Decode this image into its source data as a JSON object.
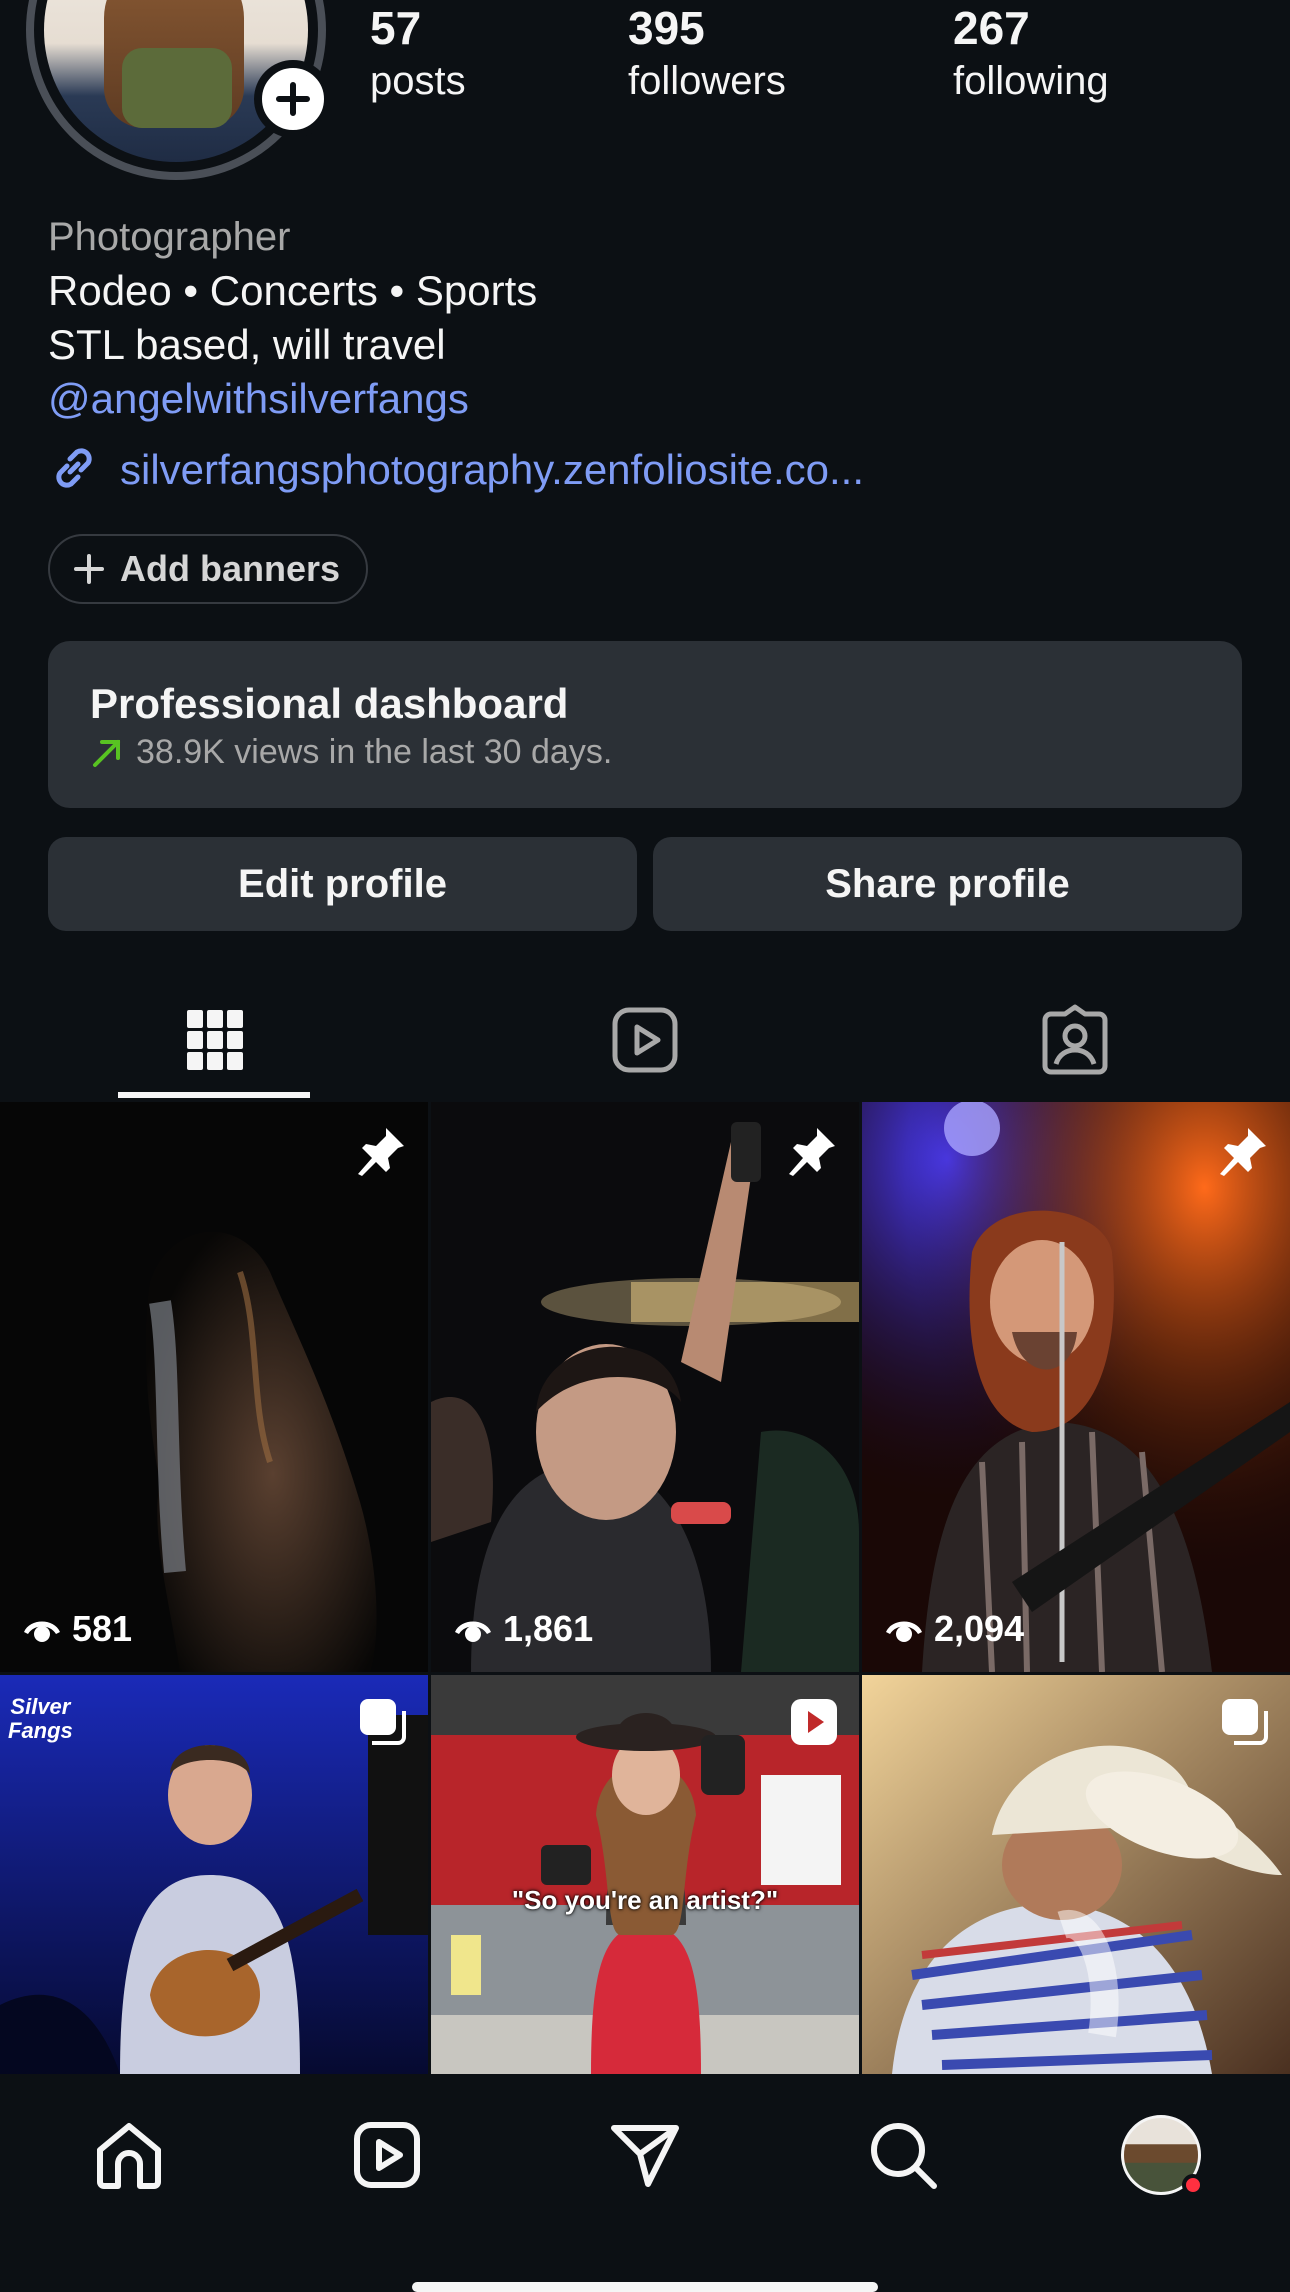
{
  "profile": {
    "stats": [
      {
        "num": "57",
        "label": "posts"
      },
      {
        "num": "395",
        "label": "followers"
      },
      {
        "num": "267",
        "label": "following"
      }
    ],
    "category": "Photographer",
    "bio_line1": "Rodeo • Concerts • Sports",
    "bio_line2": "STL based, will travel",
    "mention": "@angelwithsilverfangs",
    "link": "silverfangsphotography.zenfoliosite.co..."
  },
  "banner_button": "Add banners",
  "dashboard": {
    "title": "Professional dashboard",
    "subtitle": "38.9K views in the last 30 days."
  },
  "buttons": {
    "edit": "Edit profile",
    "share": "Share profile"
  },
  "tabs": [
    "grid-tab",
    "reels-tab",
    "tagged-tab"
  ],
  "grid": [
    {
      "views": "581",
      "badge": "pin",
      "scene": "horse"
    },
    {
      "views": "1,861",
      "badge": "pin",
      "scene": "crowd"
    },
    {
      "views": "2,094",
      "badge": "pin",
      "scene": "singer"
    },
    {
      "badge": "carousel",
      "scene": "guitarist"
    },
    {
      "badge": "reel",
      "scene": "cowgirl",
      "caption": "\"So you're an artist?\""
    },
    {
      "badge": "carousel",
      "scene": "cowboy"
    }
  ],
  "bottom_nav": [
    "home-icon",
    "reels-icon",
    "messages-icon",
    "search-icon",
    "profile-avatar"
  ],
  "colors": {
    "background": "#0c1014",
    "link": "#7f9cf5",
    "card": "#2b3036",
    "trend": "#58c322",
    "notification": "#ff3040"
  }
}
